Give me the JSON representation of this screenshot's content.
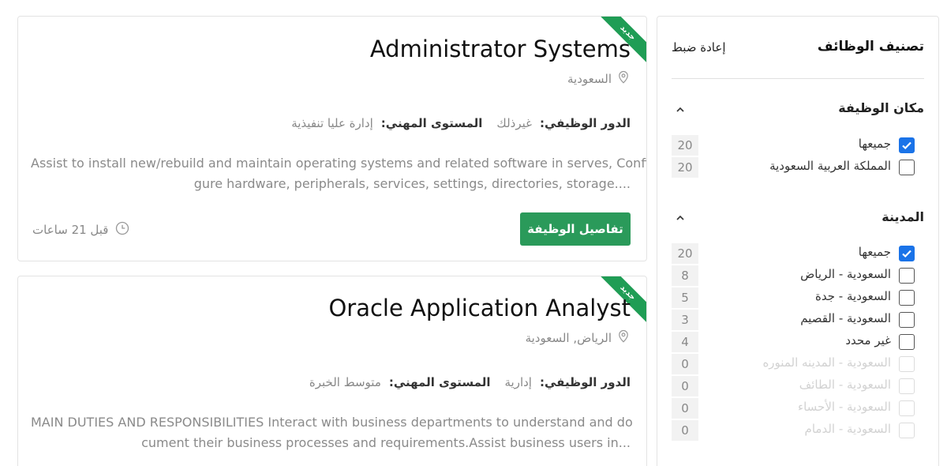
{
  "jobs": [
    {
      "badge": "جديد",
      "title": "Administrator Systems",
      "location": "السعودية",
      "role_label": "الدور الوظيفي:",
      "role_value": "غيرذلك",
      "level_label": "المستوى المهني:",
      "level_value": "إدارة عليا تنفيذية",
      "desc_line1": "Assist to install new/rebuild and maintain operating systems and related software in serves, Confi",
      "desc_line2": "gure hardware, peripherals, services, settings, directories, storage....",
      "details_button": "تفاصيل الوظيفة",
      "posted": "قبل 21 ساعات"
    },
    {
      "badge": "جديد",
      "title": "Oracle Application Analyst",
      "location": "الرياض, السعودية",
      "role_label": "الدور الوظيفي:",
      "role_value": "إدارية",
      "level_label": "المستوى المهني:",
      "level_value": "متوسط الخبرة",
      "desc_line1": "MAIN DUTIES AND RESPONSIBILITIES    Interact with business departments to understand and do",
      "desc_line2": "cument their business processes and requirements.Assist business users in..."
    }
  ],
  "sidebar": {
    "title": "تصنيف الوظائف",
    "reset": "إعادة ضبط",
    "sections": [
      {
        "title": "مكان الوظيفة",
        "items": [
          {
            "label": "جميعها",
            "count": "20",
            "checked": true,
            "disabled": false
          },
          {
            "label": "المملكة العربية السعودية",
            "count": "20",
            "checked": false,
            "disabled": false
          }
        ]
      },
      {
        "title": "المدينة",
        "items": [
          {
            "label": "جميعها",
            "count": "20",
            "checked": true,
            "disabled": false
          },
          {
            "label": "السعودية - الرياض",
            "count": "8",
            "checked": false,
            "disabled": false
          },
          {
            "label": "السعودية - جدة",
            "count": "5",
            "checked": false,
            "disabled": false
          },
          {
            "label": "السعودية - القصيم",
            "count": "3",
            "checked": false,
            "disabled": false
          },
          {
            "label": "غير محدد",
            "count": "4",
            "checked": false,
            "disabled": false
          },
          {
            "label": "السعودية - المدينه المنوره",
            "count": "0",
            "checked": false,
            "disabled": true
          },
          {
            "label": "السعودية - الطائف",
            "count": "0",
            "checked": false,
            "disabled": true
          },
          {
            "label": "السعودية - الأحساء",
            "count": "0",
            "checked": false,
            "disabled": true
          },
          {
            "label": "السعودية - الدمام",
            "count": "0",
            "checked": false,
            "disabled": true
          }
        ]
      }
    ]
  },
  "colors": {
    "accent_green": "#2a9a5a",
    "ribbon_green": "#1f9d55",
    "checkbox_blue": "#1a73e8"
  },
  "icons": {
    "location": "map-pin-icon",
    "time": "clock-icon",
    "collapse": "chevron-up-icon",
    "check": "check-icon"
  }
}
